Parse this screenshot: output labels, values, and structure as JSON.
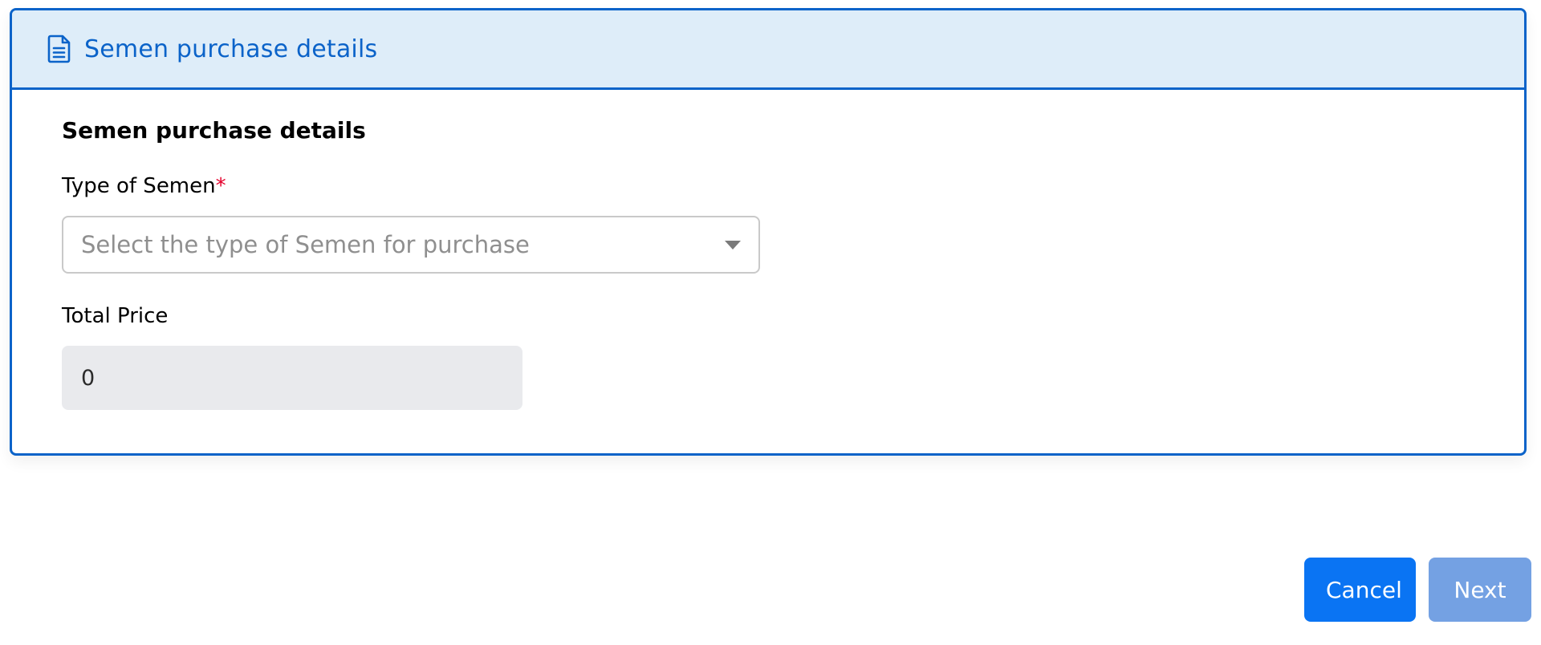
{
  "card": {
    "header_title": "Semen purchase details",
    "header_icon": "document-icon",
    "section_title": "Semen purchase details"
  },
  "form": {
    "type_label": "Type of Semen",
    "type_required_mark": "*",
    "type_placeholder": "Select the type of Semen for purchase",
    "price_label": "Total Price",
    "price_value": "0"
  },
  "actions": {
    "cancel_label": "Cancel",
    "next_label": "Next"
  },
  "colors": {
    "accent": "#0b63c9",
    "header_bg": "#deedf9",
    "primary_button": "#0a74f3",
    "disabled_button": "#74a1e3",
    "required": "#e4002b"
  }
}
